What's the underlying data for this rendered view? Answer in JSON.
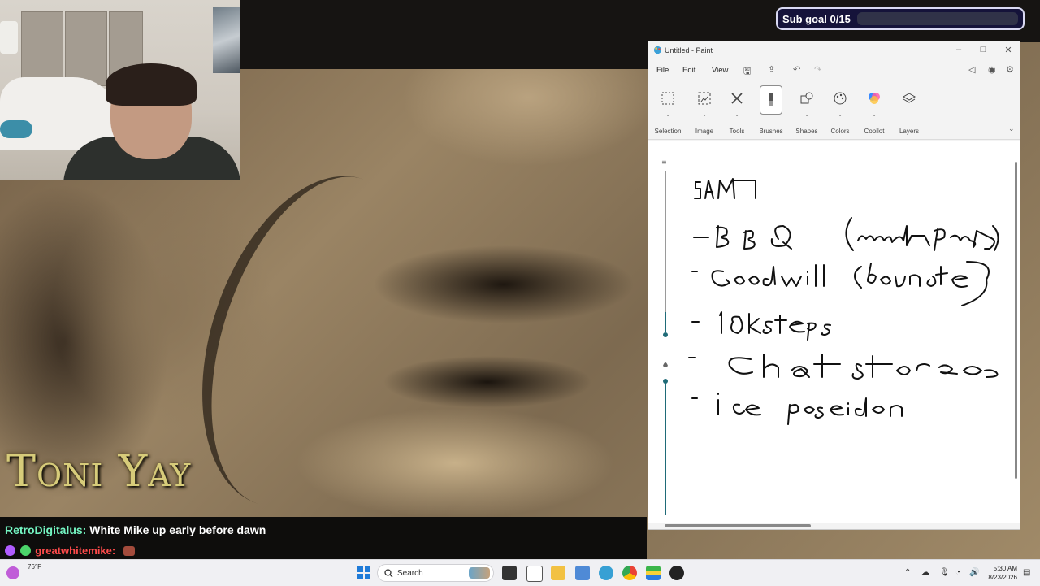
{
  "subgoal": {
    "label": "Sub goal 0/15",
    "progress": 0.0
  },
  "logo": {
    "text": "Toni Yay"
  },
  "chat": {
    "messages": [
      {
        "user": "RetroDigitalus:",
        "text": "White Mike up early before dawn"
      },
      {
        "user": "greatwhitemike:",
        "text": ""
      }
    ],
    "partial_user": "greatwhitemike:"
  },
  "paint": {
    "title": "Untitled - Paint",
    "menu": [
      "File",
      "Edit",
      "View"
    ],
    "tools": [
      {
        "label": "Selection",
        "icon": "selection-icon"
      },
      {
        "label": "Image",
        "icon": "image-icon"
      },
      {
        "label": "Tools",
        "icon": "tools-icon"
      },
      {
        "label": "Brushes",
        "icon": "brush-icon"
      },
      {
        "label": "Shapes",
        "icon": "shapes-icon"
      },
      {
        "label": "Colors",
        "icon": "palette-icon"
      },
      {
        "label": "Copilot",
        "icon": "copilot-icon"
      },
      {
        "label": "Layers",
        "icon": "layers-icon"
      }
    ],
    "selected_tool": "Brushes",
    "handwriting": [
      "5AM",
      "- BBQ (meal Prep)",
      "- Goodwill (donate)",
      "- 10k steps",
      "- Chat stories",
      "- ice poseidon"
    ]
  },
  "taskbar": {
    "search_placeholder": "Search",
    "weather": "76°F",
    "time": "5:30 AM",
    "date": "8/23/2026"
  },
  "colors": {
    "accent": "#7e6cf0",
    "chat_user1": "#74f5c2",
    "chat_user2": "#ff4b4b",
    "logo": "#d7cc7a",
    "slider": "#1f6b78"
  }
}
